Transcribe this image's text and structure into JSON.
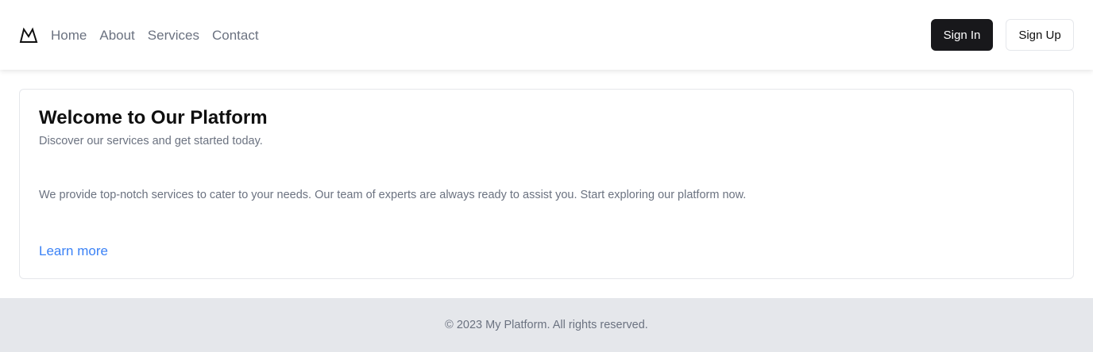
{
  "header": {
    "logo_icon": "mountain-icon",
    "nav": [
      {
        "label": "Home"
      },
      {
        "label": "About"
      },
      {
        "label": "Services"
      },
      {
        "label": "Contact"
      }
    ],
    "sign_in_label": "Sign In",
    "sign_up_label": "Sign Up"
  },
  "card": {
    "title": "Welcome to Our Platform",
    "subtitle": "Discover our services and get started today.",
    "body": "We provide top-notch services to cater to your needs. Our team of experts are always ready to assist you. Start exploring our platform now.",
    "link_label": "Learn more"
  },
  "footer": {
    "text": "© 2023 My Platform. All rights reserved."
  },
  "colors": {
    "primary_button": "#18181b",
    "link": "#3b82f6",
    "muted_text": "#6b7280",
    "footer_bg": "#e5e7eb"
  }
}
